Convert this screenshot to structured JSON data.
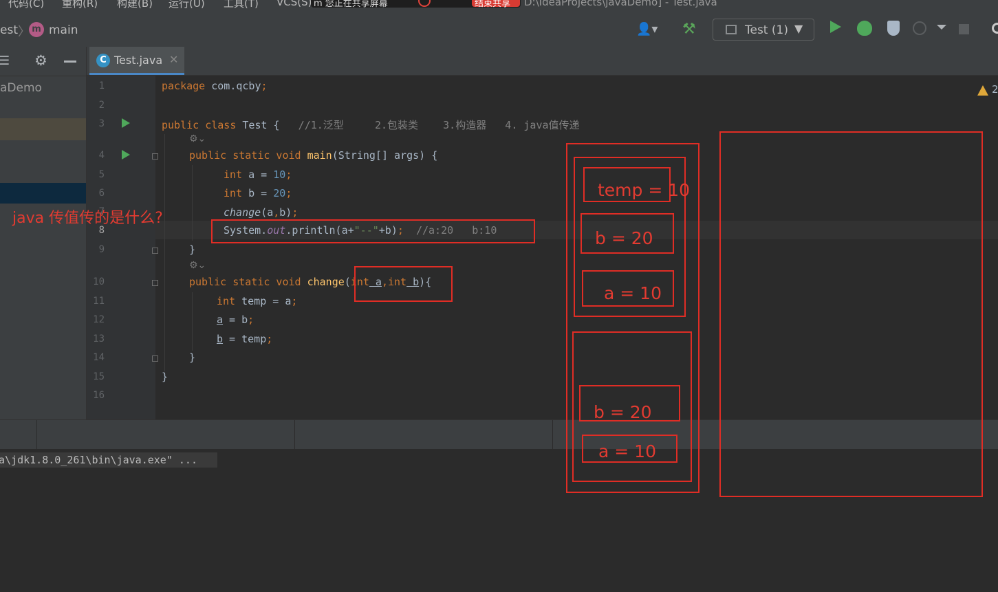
{
  "menu": {
    "items": [
      "代码(C)",
      "重构(R)",
      "构建(B)",
      "运行(U)",
      "工具(T)",
      "VCS(S)"
    ],
    "notification": "m 您正在共享屏幕",
    "stop_share_label": "结束共享",
    "window_title": "D:\\IdeaProjects\\javaDemo] - Test.java"
  },
  "navbar": {
    "crumb_project": "est",
    "crumb_method": "main",
    "module_letter": "m",
    "run_config_label": "Test (1)",
    "icons": [
      "user-icon",
      "hammer-icon",
      "run-icon",
      "debug-icon",
      "coverage-icon",
      "profile-icon",
      "more-icon",
      "stop-icon",
      "search-icon"
    ]
  },
  "project_panel": {
    "root_label": "aDemo"
  },
  "tab": {
    "label": "Test.java",
    "class_letter": "C"
  },
  "editor": {
    "warning_count": "2",
    "line_numbers": [
      "1",
      "2",
      "3",
      "4",
      "5",
      "6",
      "7",
      "8",
      "9",
      "10",
      "11",
      "12",
      "13",
      "14",
      "15",
      "16"
    ],
    "lines": {
      "l1": {
        "kw": "package",
        "rest": " com.qcby",
        "end": ";"
      },
      "l3": {
        "kw": "public class",
        "name": " Test {",
        "comment": "   //1.泛型     2.包装类    3.构造器   4. java值传递"
      },
      "l4": {
        "kw": "public static void",
        "fn": "main",
        "rest": "(String[] args) {"
      },
      "l5": {
        "kw": "int",
        "rest": " a = ",
        "num": "10",
        "end": ";"
      },
      "l6": {
        "kw": "int",
        "rest": " b = ",
        "num": "20",
        "end": ";"
      },
      "l7": {
        "fn": "change",
        "rest": "(a",
        "sep": ",",
        "rest2": "b)",
        "end": ";"
      },
      "l8": {
        "a": "System.",
        "field": "out",
        "b": ".println(a+",
        "str": "\"--\"",
        "c": "+b)",
        "end": ";",
        "comment": "  //a:20   b:10"
      },
      "l9": {
        "text": "}"
      },
      "l10": {
        "kw": "public static void",
        "fn": "change",
        "p1": "(",
        "kw2": "int",
        "a": " a",
        "sep": ",",
        "kw3": "int",
        "b": " b",
        "p2": "){"
      },
      "l11": {
        "kw": "int",
        "rest": " temp = a",
        "end": ";"
      },
      "l12": {
        "var": "a",
        "rest": " = b",
        "end": ";"
      },
      "l13": {
        "var": "b",
        "rest": " = temp",
        "end": ";"
      },
      "l14": {
        "text": "}"
      },
      "l15": {
        "text": "}"
      }
    }
  },
  "console": {
    "line": "a\\jdk1.8.0_261\\bin\\java.exe\" ..."
  },
  "annotations": {
    "question": "java 传值传的是什么?",
    "frame_change": {
      "temp": "temp = 10",
      "b": "b  = 20",
      "a": "a = 10"
    },
    "frame_main": {
      "b": "b = 20",
      "a": "a  = 10"
    }
  },
  "colors": {
    "annotation_red": "#e02d25",
    "editor_bg": "#2b2b2b",
    "keyword": "#cc7832",
    "number": "#6897bb",
    "string": "#6a8759",
    "comment": "#808080",
    "function": "#ffc66d"
  }
}
